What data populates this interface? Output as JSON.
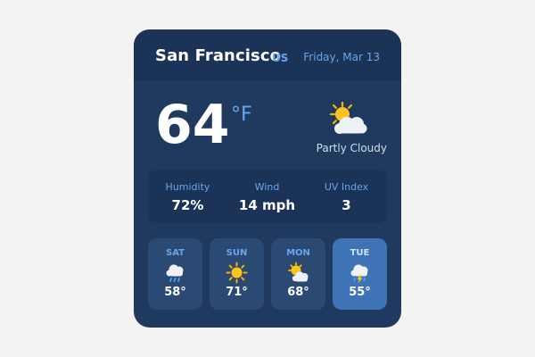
{
  "header": {
    "city": "San Francisco",
    "country": "US",
    "date": "Friday, Mar 13"
  },
  "current": {
    "temperature": "64",
    "unit": "°F",
    "condition": "Partly Cloudy",
    "icon": "partly-cloudy-icon"
  },
  "stats": [
    {
      "label": "Humidity",
      "value": "72%"
    },
    {
      "label": "Wind",
      "value": "14 mph"
    },
    {
      "label": "UV Index",
      "value": "3"
    }
  ],
  "forecast": [
    {
      "day": "SAT",
      "temp": "58°",
      "icon": "rain-cloud-icon",
      "active": false
    },
    {
      "day": "SUN",
      "temp": "71°",
      "icon": "sun-icon",
      "active": false
    },
    {
      "day": "MON",
      "temp": "68°",
      "icon": "sun-behind-cloud-icon",
      "active": false
    },
    {
      "day": "TUE",
      "temp": "55°",
      "icon": "thunder-cloud-icon",
      "active": true
    }
  ],
  "colors": {
    "page_background": "#f3f3f3",
    "card_background": "#203a5f",
    "header_background": "#1c3358",
    "accent": "#66a6ec",
    "active_day": "#3e73b6"
  }
}
